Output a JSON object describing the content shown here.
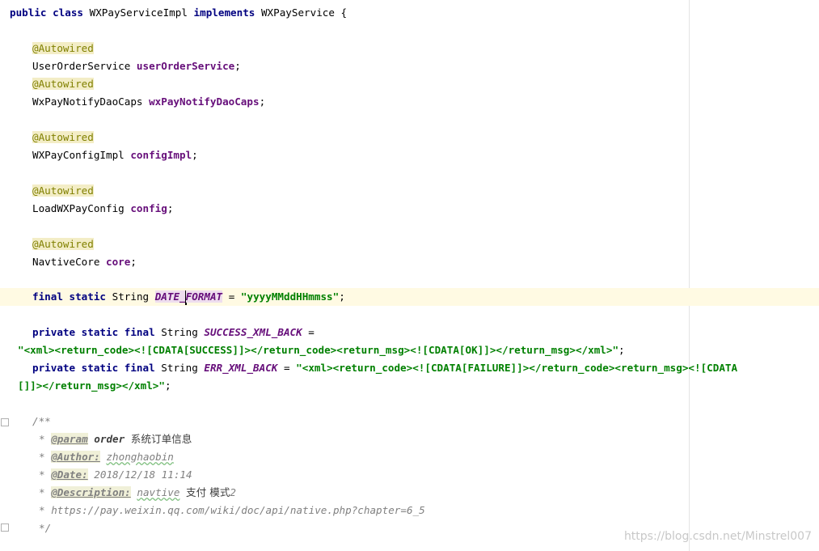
{
  "code": {
    "class_decl": {
      "kw1": "public",
      "kw2": "class",
      "name": "WXPayServiceImpl",
      "kw3": "implements",
      "iface": "WXPayService",
      "brace": "{"
    },
    "annotation": "@Autowired",
    "fields": [
      {
        "type": "UserOrderService",
        "name": "userOrderService"
      },
      {
        "type": "WxPayNotifyDaoCaps",
        "name": "wxPayNotifyDaoCaps"
      },
      {
        "type": "WXPayConfigImpl",
        "name": "configImpl"
      },
      {
        "type": "LoadWXPayConfig",
        "name": "config"
      },
      {
        "type": "NavtiveCore",
        "name": "core"
      }
    ],
    "semicolon": ";",
    "date_format": {
      "kw_final": "final",
      "kw_static": "static",
      "type": "String",
      "name_a": "DATE_",
      "name_b": "FORMAT",
      "eq": "=",
      "value": "\"yyyyMMddHHmmss\""
    },
    "success": {
      "kw_private": "private",
      "kw_static": "static",
      "kw_final": "final",
      "type": "String",
      "name": "SUCCESS_XML_BACK",
      "eq": "=",
      "value": "\"<xml><return_code><![CDATA[SUCCESS]]></return_code><return_msg><![CDATA[OK]]></return_msg></xml>\""
    },
    "err": {
      "kw_private": "private",
      "kw_static": "static",
      "kw_final": "final",
      "type": "String",
      "name": "ERR_XML_BACK",
      "eq": "=",
      "value_line1": "\"<xml><return_code><![CDATA[FAILURE]]></return_code><return_msg><![CDATA",
      "value_line2": "[]]></return_msg></xml>\""
    },
    "javadoc": {
      "open": "/**",
      "star": "*",
      "param_tag": "@param",
      "param_name": "order",
      "param_desc": "系统订单信息",
      "author_tag": "@Author:",
      "author_val": "zhonghaobin",
      "date_tag": "@Date:",
      "date_val": "2018/12/18 11:14",
      "desc_tag": "@Description:",
      "desc_val1": "navtive",
      "desc_val2": "支付 模式",
      "desc_val3": "2",
      "link": "https://pay.weixin.qq.com/wiki/doc/api/native.php?chapter=6_5",
      "close": "*/"
    }
  },
  "watermark": "https://blog.csdn.net/Minstrel007"
}
